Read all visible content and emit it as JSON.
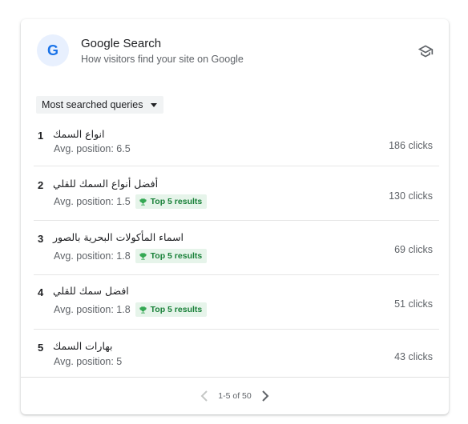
{
  "header": {
    "logo_letter": "G",
    "title": "Google Search",
    "subtitle": "How visitors find your site on Google",
    "learn_icon": "school-icon"
  },
  "filter": {
    "selected": "Most searched queries"
  },
  "rows": [
    {
      "rank": "1",
      "query": "انواع السمك",
      "position": "Avg. position: 6.5",
      "badge": "",
      "clicks": "186 clicks"
    },
    {
      "rank": "2",
      "query": "أفضل أنواع السمك للقلي",
      "position": "Avg. position: 1.5",
      "badge": "Top 5 results",
      "clicks": "130 clicks"
    },
    {
      "rank": "3",
      "query": "اسماء المأكولات البحرية بالصور",
      "position": "Avg. position: 1.8",
      "badge": "Top 5 results",
      "clicks": "69 clicks"
    },
    {
      "rank": "4",
      "query": "افضل سمك للقلي",
      "position": "Avg. position: 1.8",
      "badge": "Top 5 results",
      "clicks": "51 clicks"
    },
    {
      "rank": "5",
      "query": "بهارات السمك",
      "position": "Avg. position: 5",
      "badge": "",
      "clicks": "43 clicks"
    }
  ],
  "pagination": {
    "range": "1-5 of 50"
  },
  "colors": {
    "accent": "#1a73e8",
    "badge_bg": "#e6f4ea",
    "badge_text": "#188038"
  }
}
